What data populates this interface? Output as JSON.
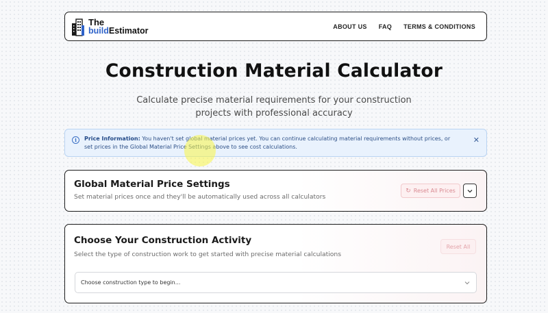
{
  "header": {
    "logo_line1": "The",
    "logo_accent": "build",
    "logo_rest": "Estimator",
    "nav": [
      "ABOUT US",
      "FAQ",
      "TERMS & CONDITIONS"
    ]
  },
  "hero": {
    "title": "Construction Material Calculator",
    "subtitle": "Calculate precise material requirements for your construction projects with professional accuracy"
  },
  "info_banner": {
    "icon": "info-icon",
    "label": "Price Information:",
    "message": "You haven't set global material prices yet. You can continue calculating material requirements without prices, or set prices in the Global Material Price Settings above to see cost calculations.",
    "close_icon": "close-icon"
  },
  "price_settings": {
    "title": "Global Material Price Settings",
    "description": "Set material prices once and they'll be automatically used across all calculators",
    "reset_button": "Reset All Prices",
    "toggle_icon": "chevron-down-icon"
  },
  "activity": {
    "title": "Choose Your Construction Activity",
    "description": "Select the type of construction work to get started with precise material calculations",
    "reset_button": "Reset All",
    "select_value": "Choose construction type to begin..."
  },
  "colors": {
    "accent_blue": "#2f63c9",
    "banner_bg": "#e9f2fd",
    "reset_red": "#d98a92",
    "border_dark": "#1c1c1c"
  }
}
